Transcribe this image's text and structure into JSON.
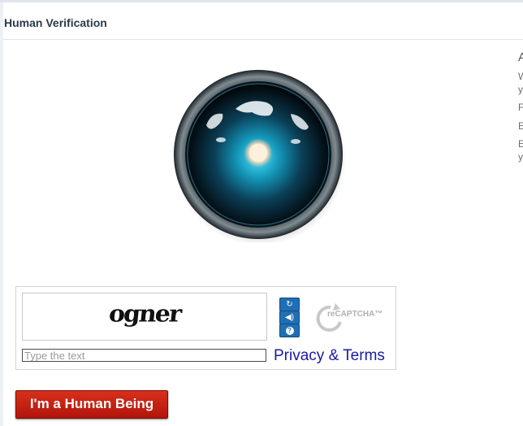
{
  "panel": {
    "title": "Human Verification"
  },
  "side": {
    "line_a": "A",
    "line_b": "W",
    "line_c": "y",
    "line_d": "F",
    "line_e": "E",
    "line_f": "E",
    "line_g": "y"
  },
  "captcha": {
    "challenge_text": "ogner",
    "refresh_icon": "refresh-icon",
    "audio_icon": "speaker-icon",
    "help_icon": "help-icon",
    "logo_text": "reCAPTCHA™",
    "input_placeholder": "Type the text",
    "input_value": "",
    "privacy_link": "Privacy & Terms"
  },
  "submit": {
    "label": "I'm a Human Being"
  },
  "colors": {
    "button": "#c0200f",
    "link": "#1a1aa6",
    "captcha_buttons": "#1f6fb5"
  }
}
